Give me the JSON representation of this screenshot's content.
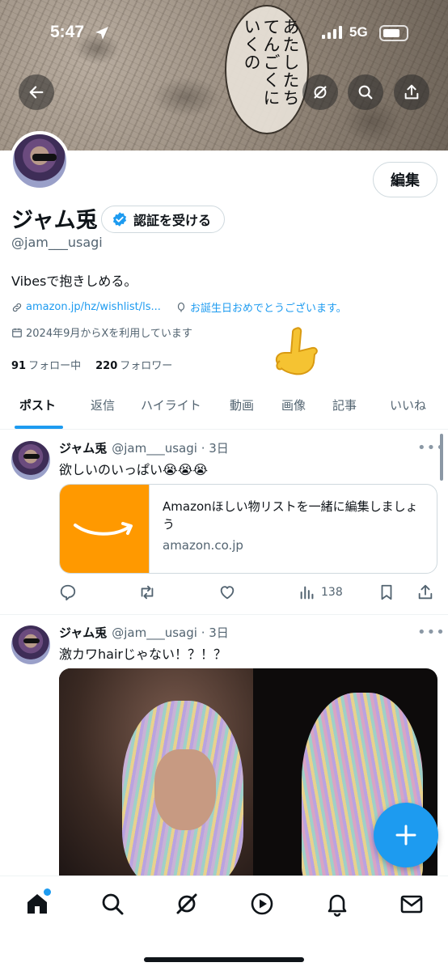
{
  "status_bar": {
    "time": "5:47",
    "network": "5G"
  },
  "banner": {
    "text_columns": [
      "あたしたち",
      "てんごくに",
      "いくの"
    ]
  },
  "profile": {
    "edit_label": "編集",
    "display_name": "ジャム兎",
    "verify_label": "認証を受ける",
    "handle": "@jam___usagi",
    "bio": "Vibesで抱きしめる。",
    "website": "amazon.jp/hz/wishlist/ls...",
    "birthday": "お誕生日おめでとうございます。",
    "joined": "2024年9月からXを利用しています",
    "following_count": "91",
    "following_label": "フォロー中",
    "followers_count": "220",
    "followers_label": "フォロワー"
  },
  "tabs": [
    {
      "label": "ポスト",
      "active": true
    },
    {
      "label": "返信"
    },
    {
      "label": "ハイライト"
    },
    {
      "label": "動画"
    },
    {
      "label": "画像"
    },
    {
      "label": "記事"
    },
    {
      "label": "いいね"
    }
  ],
  "posts": [
    {
      "name": "ジャム兎",
      "handle_time": "@jam___usagi · 3日",
      "more": "•••",
      "text": "欲しいのいっぱい😭😭😭",
      "card": {
        "title": "Amazonほしい物リストを一緒に編集しましょう",
        "domain": "amazon.co.jp"
      },
      "view_count": "138"
    },
    {
      "name": "ジャム兎",
      "handle_time": "@jam___usagi · 3日",
      "more": "•••",
      "text": "激カワhairじゃない！？！？"
    }
  ],
  "colors": {
    "accent": "#1d9bf0",
    "amazon": "#ff9900",
    "text": "#0f1419",
    "muted": "#536471"
  },
  "icons": {
    "back": "arrow-left-icon",
    "grok": "grok-icon",
    "search": "search-icon",
    "share": "share-icon",
    "nav": [
      "home-icon",
      "search-icon",
      "grok-icon",
      "video-icon",
      "bell-icon",
      "mail-icon"
    ]
  }
}
